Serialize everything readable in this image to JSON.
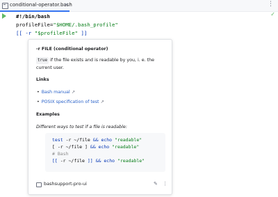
{
  "tabbar": {
    "file_tab": "conditional-operator.bash",
    "close_glyph": "×",
    "menu_glyph": "⋮"
  },
  "editor": {
    "status_glyph": "✓",
    "lines": {
      "l1": "#!/bin/bash",
      "l2_var": "profileFile=",
      "l2_str": "\"$HOME/.bash_profile\"",
      "l3_open": "[[ -r ",
      "l3_str": "\"$profileFile\"",
      "l3_close": " ]]"
    }
  },
  "popup": {
    "title": "-r FILE (conditional operator)",
    "desc_code": "true",
    "desc_rest": " if the file exists and is readable by you, i. e. the",
    "desc_line2": "current user.",
    "links_heading": "Links",
    "links": [
      {
        "label": "Bash manual",
        "ext": "↗"
      },
      {
        "label": "POSIX specification of test",
        "ext": "↗"
      }
    ],
    "examples_heading": "Examples",
    "examples_desc": "Different ways to test if a file is readable:",
    "examples": {
      "e1_cmd": "test",
      "e1_mid": " -r ~/file ",
      "e1_op": "&& echo",
      "e1_str": " \"readable\"",
      "e2_cmd": "[ -r ~/file ] ",
      "e2_op": "&& echo",
      "e2_str": " \"readable\"",
      "e3_comment": "# Bash",
      "e4_cmd": "[[ ",
      "e4_mid": "-r ~/file ",
      "e4_close": "]] ",
      "e4_op": "&& echo",
      "e4_str": " \"readable\""
    },
    "footer_label": "bashsupport-pro-ui",
    "edit_glyph": "✎",
    "more_glyph": "⋮"
  }
}
